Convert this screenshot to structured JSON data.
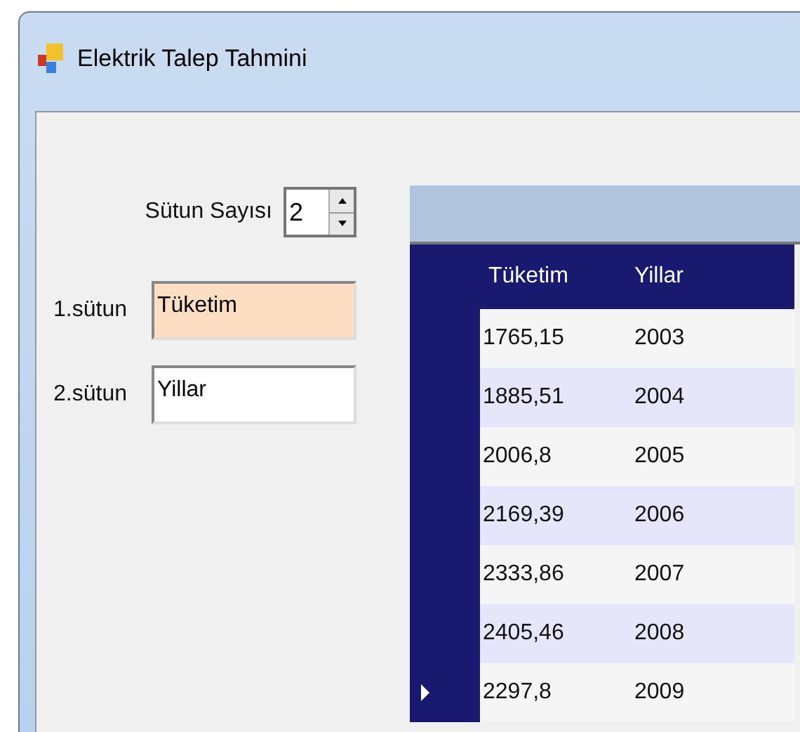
{
  "window": {
    "title": "Elektrik Talep Tahmini"
  },
  "column_count": {
    "label": "Sütun Sayısı",
    "value": "2"
  },
  "column_fields": [
    {
      "label": "1.sütun",
      "value": "Tüketim",
      "focused": true
    },
    {
      "label": "2.sütun",
      "value": "Yillar",
      "focused": false
    }
  ],
  "table": {
    "columns": [
      "Tüketim",
      "Yillar"
    ],
    "rows": [
      {
        "cells": [
          "1765,15",
          "2003"
        ],
        "current": false
      },
      {
        "cells": [
          "1885,51",
          "2004"
        ],
        "current": false
      },
      {
        "cells": [
          "2006,8",
          "2005"
        ],
        "current": false
      },
      {
        "cells": [
          "2169,39",
          "2006"
        ],
        "current": false
      },
      {
        "cells": [
          "2333,86",
          "2007"
        ],
        "current": false
      },
      {
        "cells": [
          "2405,46",
          "2008"
        ],
        "current": false
      },
      {
        "cells": [
          "2297,8",
          "2009"
        ],
        "current": true
      }
    ]
  }
}
